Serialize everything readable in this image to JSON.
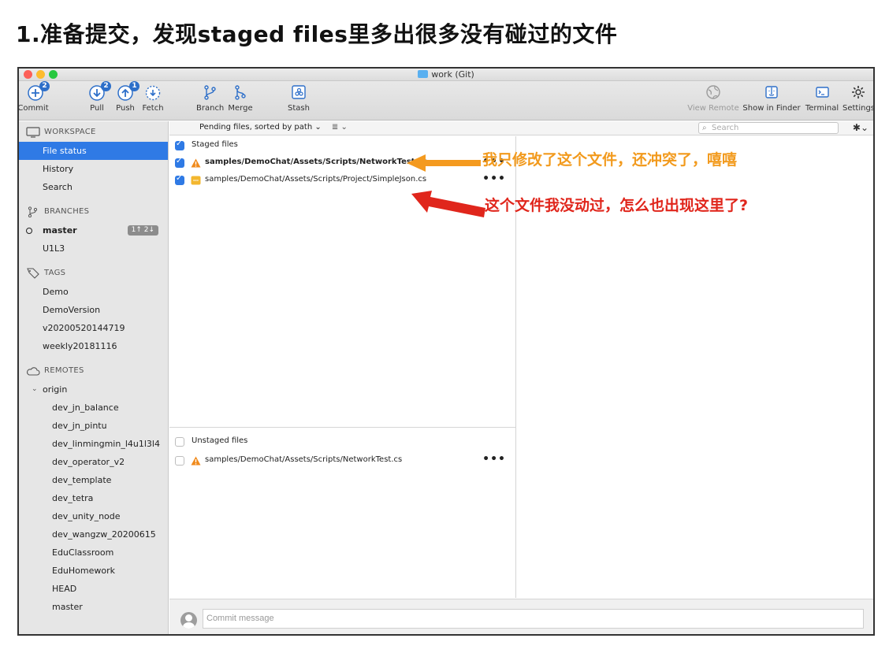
{
  "page_heading": "1.准备提交，发现staged files里多出很多没有碰过的文件",
  "window": {
    "title": "work (Git)"
  },
  "toolbar": {
    "commit": {
      "label": "Commit",
      "icon": "commit-icon",
      "badge": "2"
    },
    "pull": {
      "label": "Pull",
      "icon": "pull-icon",
      "badge": "2"
    },
    "push": {
      "label": "Push",
      "icon": "push-icon",
      "badge": "1"
    },
    "fetch": {
      "label": "Fetch",
      "icon": "fetch-icon"
    },
    "branch": {
      "label": "Branch",
      "icon": "branch-icon"
    },
    "merge": {
      "label": "Merge",
      "icon": "merge-icon"
    },
    "stash": {
      "label": "Stash",
      "icon": "stash-icon"
    },
    "view_remote": {
      "label": "View Remote",
      "icon": "globe-icon"
    },
    "show_in_finder": {
      "label": "Show in Finder",
      "icon": "finder-icon"
    },
    "terminal": {
      "label": "Terminal",
      "icon": "terminal-icon"
    },
    "settings": {
      "label": "Settings",
      "icon": "gear-icon"
    }
  },
  "sidebar": {
    "workspace": {
      "header": "WORKSPACE",
      "items": [
        "File status",
        "History",
        "Search"
      ],
      "selected": "File status"
    },
    "branches": {
      "header": "BRANCHES",
      "items": [
        {
          "label": "master",
          "current": true,
          "ahead_behind": "1↑ 2↓"
        },
        {
          "label": "U1L3"
        }
      ]
    },
    "tags": {
      "header": "TAGS",
      "items": [
        "Demo",
        "DemoVersion",
        "v20200520144719",
        "weekly20181116"
      ]
    },
    "remotes": {
      "header": "REMOTES",
      "origin": "origin",
      "items": [
        "dev_jn_balance",
        "dev_jn_pintu",
        "dev_linmingmin_l4u1l3l4",
        "dev_operator_v2",
        "dev_template",
        "dev_tetra",
        "dev_unity_node",
        "dev_wangzw_20200615",
        "EduClassroom",
        "EduHomework",
        "HEAD",
        "master"
      ]
    }
  },
  "filter_bar": {
    "sort_label": "Pending files, sorted by path ⌄",
    "list_mode": "≣ ⌄",
    "search_placeholder": "Search"
  },
  "staged": {
    "header": "Staged files",
    "files": [
      {
        "path": "samples/DemoChat/Assets/Scripts/NetworkTest.cs",
        "status": "conflict",
        "status_color": "#f08a1c"
      },
      {
        "path": "samples/DemoChat/Assets/Scripts/Project/SimpleJson.cs",
        "status": "modified",
        "status_color": "#f3b72f"
      }
    ]
  },
  "unstaged": {
    "header": "Unstaged files",
    "files": [
      {
        "path": "samples/DemoChat/Assets/Scripts/NetworkTest.cs",
        "status": "conflict",
        "status_color": "#f08a1c"
      }
    ]
  },
  "more_label": "•••",
  "commit": {
    "placeholder": "Commit message"
  },
  "annotations": {
    "first": "我只修改了这个文件，还冲突了，嘻嘻",
    "second": "这个文件我没动过，怎么也出现这里了?",
    "first_color": "#f29a1d",
    "second_color": "#e0261c"
  },
  "colors": {
    "accent": "#2f7ae5",
    "badge": "#2d6fc9"
  }
}
